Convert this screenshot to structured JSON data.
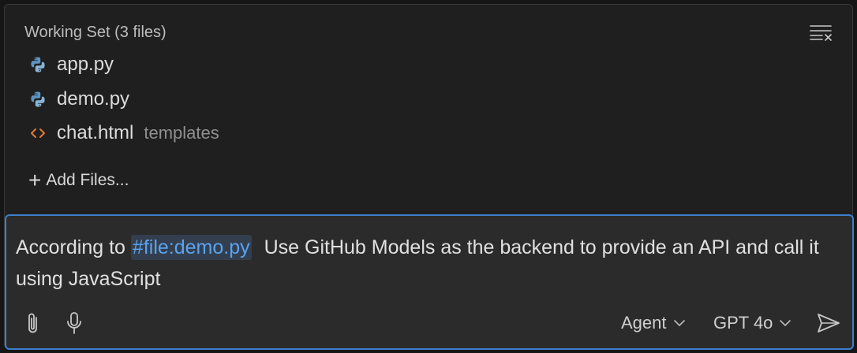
{
  "working_set": {
    "title": "Working Set (3 files)",
    "files": [
      {
        "name": "app.py",
        "dir": "",
        "icon": "python-file-icon"
      },
      {
        "name": "demo.py",
        "dir": "",
        "icon": "python-file-icon"
      },
      {
        "name": "chat.html",
        "dir": "templates",
        "icon": "html-file-icon"
      }
    ],
    "add_files_label": "Add Files..."
  },
  "chat_input": {
    "prefix": "According to",
    "file_reference": "#file:demo.py",
    "suffix": "Use GitHub Models as the backend to provide an API and call it using JavaScript"
  },
  "toolbar": {
    "mode": "Agent",
    "model": "GPT 4o",
    "attach_icon": "paperclip-icon",
    "mic_icon": "microphone-icon",
    "send_icon": "send-icon"
  },
  "colors": {
    "accent": "#3d7fce",
    "chip_text": "#5aa3f0",
    "python_icon": "#5d93c1",
    "html_icon": "#e37933"
  }
}
